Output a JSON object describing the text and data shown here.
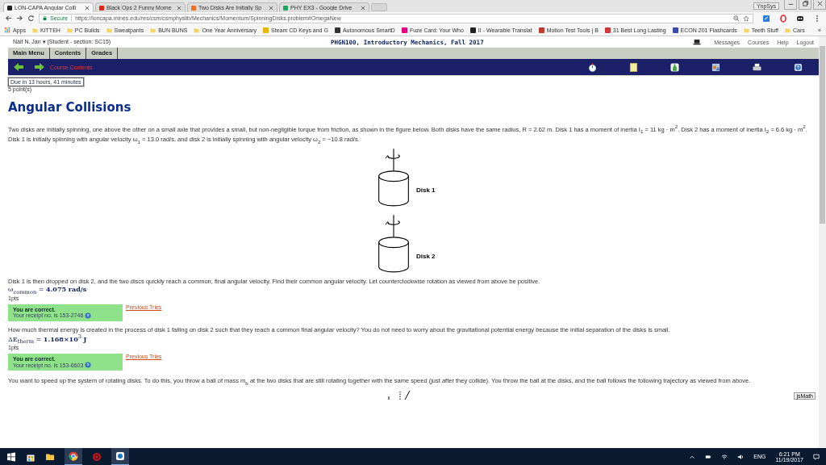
{
  "browser": {
    "tabs": [
      {
        "title": "LON-CAPA Angular Colli",
        "selected": true,
        "color": "#222222"
      },
      {
        "title": "Black Ops 2 Funny Mome",
        "selected": false,
        "color": "#e62117"
      },
      {
        "title": "Two Disks Are Initially Sp",
        "selected": false,
        "color": "#f37021"
      },
      {
        "title": "PHY EX3 - Google Drive",
        "selected": false,
        "color": "#1fa463"
      }
    ],
    "profile_badge": "YnpSys",
    "secure_label": "Secure",
    "url": "https://loncapa.mines.edu/res/csm/csmphyslib/Mechanics/Momentum/SpinningDisks.problem#OmegaNew",
    "bookmarks": [
      {
        "kind": "apps",
        "label": "Apps"
      },
      {
        "kind": "folder",
        "label": "KITTEH"
      },
      {
        "kind": "folder",
        "label": "PC Builds"
      },
      {
        "kind": "folder",
        "label": "Sweatpants"
      },
      {
        "kind": "folder",
        "label": "BUN BUNS"
      },
      {
        "kind": "folder",
        "label": "One Year Anniversary"
      },
      {
        "kind": "site",
        "label": "Steam CD Keys and G",
        "color": "#e8b400"
      },
      {
        "kind": "site",
        "label": "Autonomous SmartD",
        "color": "#333333"
      },
      {
        "kind": "site",
        "label": "Fuze Card: Your Who",
        "color": "#e6007e"
      },
      {
        "kind": "site",
        "label": "II - Wearable Translat",
        "color": "#222222"
      },
      {
        "kind": "site",
        "label": "Motion Test Tools | B",
        "color": "#c0392b"
      },
      {
        "kind": "site",
        "label": "31 Best Long Lasting",
        "color": "#d0363a"
      },
      {
        "kind": "site",
        "label": "ECON 201 Flashcards",
        "color": "#3949ab"
      },
      {
        "kind": "folder",
        "label": "Teeth Stuff"
      },
      {
        "kind": "folder",
        "label": "Cars"
      }
    ],
    "overflow": "»"
  },
  "header": {
    "user": "Naif N. Jan ▾ (Student  - section: SC15)",
    "course": "PHGN100, Introductory Mechanics, Fall 2017",
    "links": [
      "Messages",
      "Courses",
      "Help",
      "Logout"
    ]
  },
  "menu": [
    "Main Menu",
    "Contents",
    "Grades"
  ],
  "nav": {
    "breadcrumb": "Course Contents"
  },
  "problem": {
    "due": "Due in 13 hours, 41 minutes",
    "points": "5 point(s)",
    "title": "Angular Collisions",
    "intro": "Two disks are initially spinning, one above the other on a small axle that provides a small, but non-negligible torque from friction, as shown in the figure below. Both disks have the same radius, R = 2.62 m. Disk 1 has a moment of inertia I$_{1}$ = 11 kg · m$^{2}$. Disk 2 has a moment of inertia I$_{2}$ = 6.6 kg · m$^{2}$. Disk 1 is initially spinning with angular velocity ω$_{1}$ = 13.0 rad/s, and disk 2 is initially spinning with angular velocity ω$_{2}$ = −10.8 rad/s.",
    "figure": [
      {
        "label": "Disk 1"
      },
      {
        "label": "Disk 2"
      }
    ],
    "parts": [
      {
        "question": "Disk 1 is then dropped on disk 2, and the two discs quickly reach a common, final angular velocity. Find their common angular velocity. Let counterclockwise rotation as viewed from above be positive.",
        "answer": "ω$_{common}$ = **4.075 rad/s**",
        "pts": "1pts",
        "result": {
          "message": "You are correct.",
          "receipt": "Your receipt no. is 153-2746",
          "link": "Previous Tries"
        }
      },
      {
        "question": "How much thermal energy is created in the process of disk 1 falling on disk 2 such that they reach a common final angular velocity? You do not need to worry about the gravitational potential energy because the initial separation of the disks is small.",
        "answer": "ΔE$_{therm}$ = **1.168×10**$^{3}$ **J**",
        "pts": "1pts",
        "result": {
          "message": "You are correct.",
          "receipt": "Your receipt no. is 153-6603",
          "link": "Previous Tries"
        }
      }
    ],
    "next_question": "You want to speed up the system of rotating disks. To do this, you throw a ball of mass m$_{b}$ at the two disks that are still rotating together with the same speed (just after they collide). You throw the ball at the disks, and the ball follows the following trajectory as viewed from above.",
    "math_button": "jsMath"
  },
  "taskbar": {
    "language": "ENG",
    "time": "6:21 PM",
    "date": "11/19/2017"
  }
}
